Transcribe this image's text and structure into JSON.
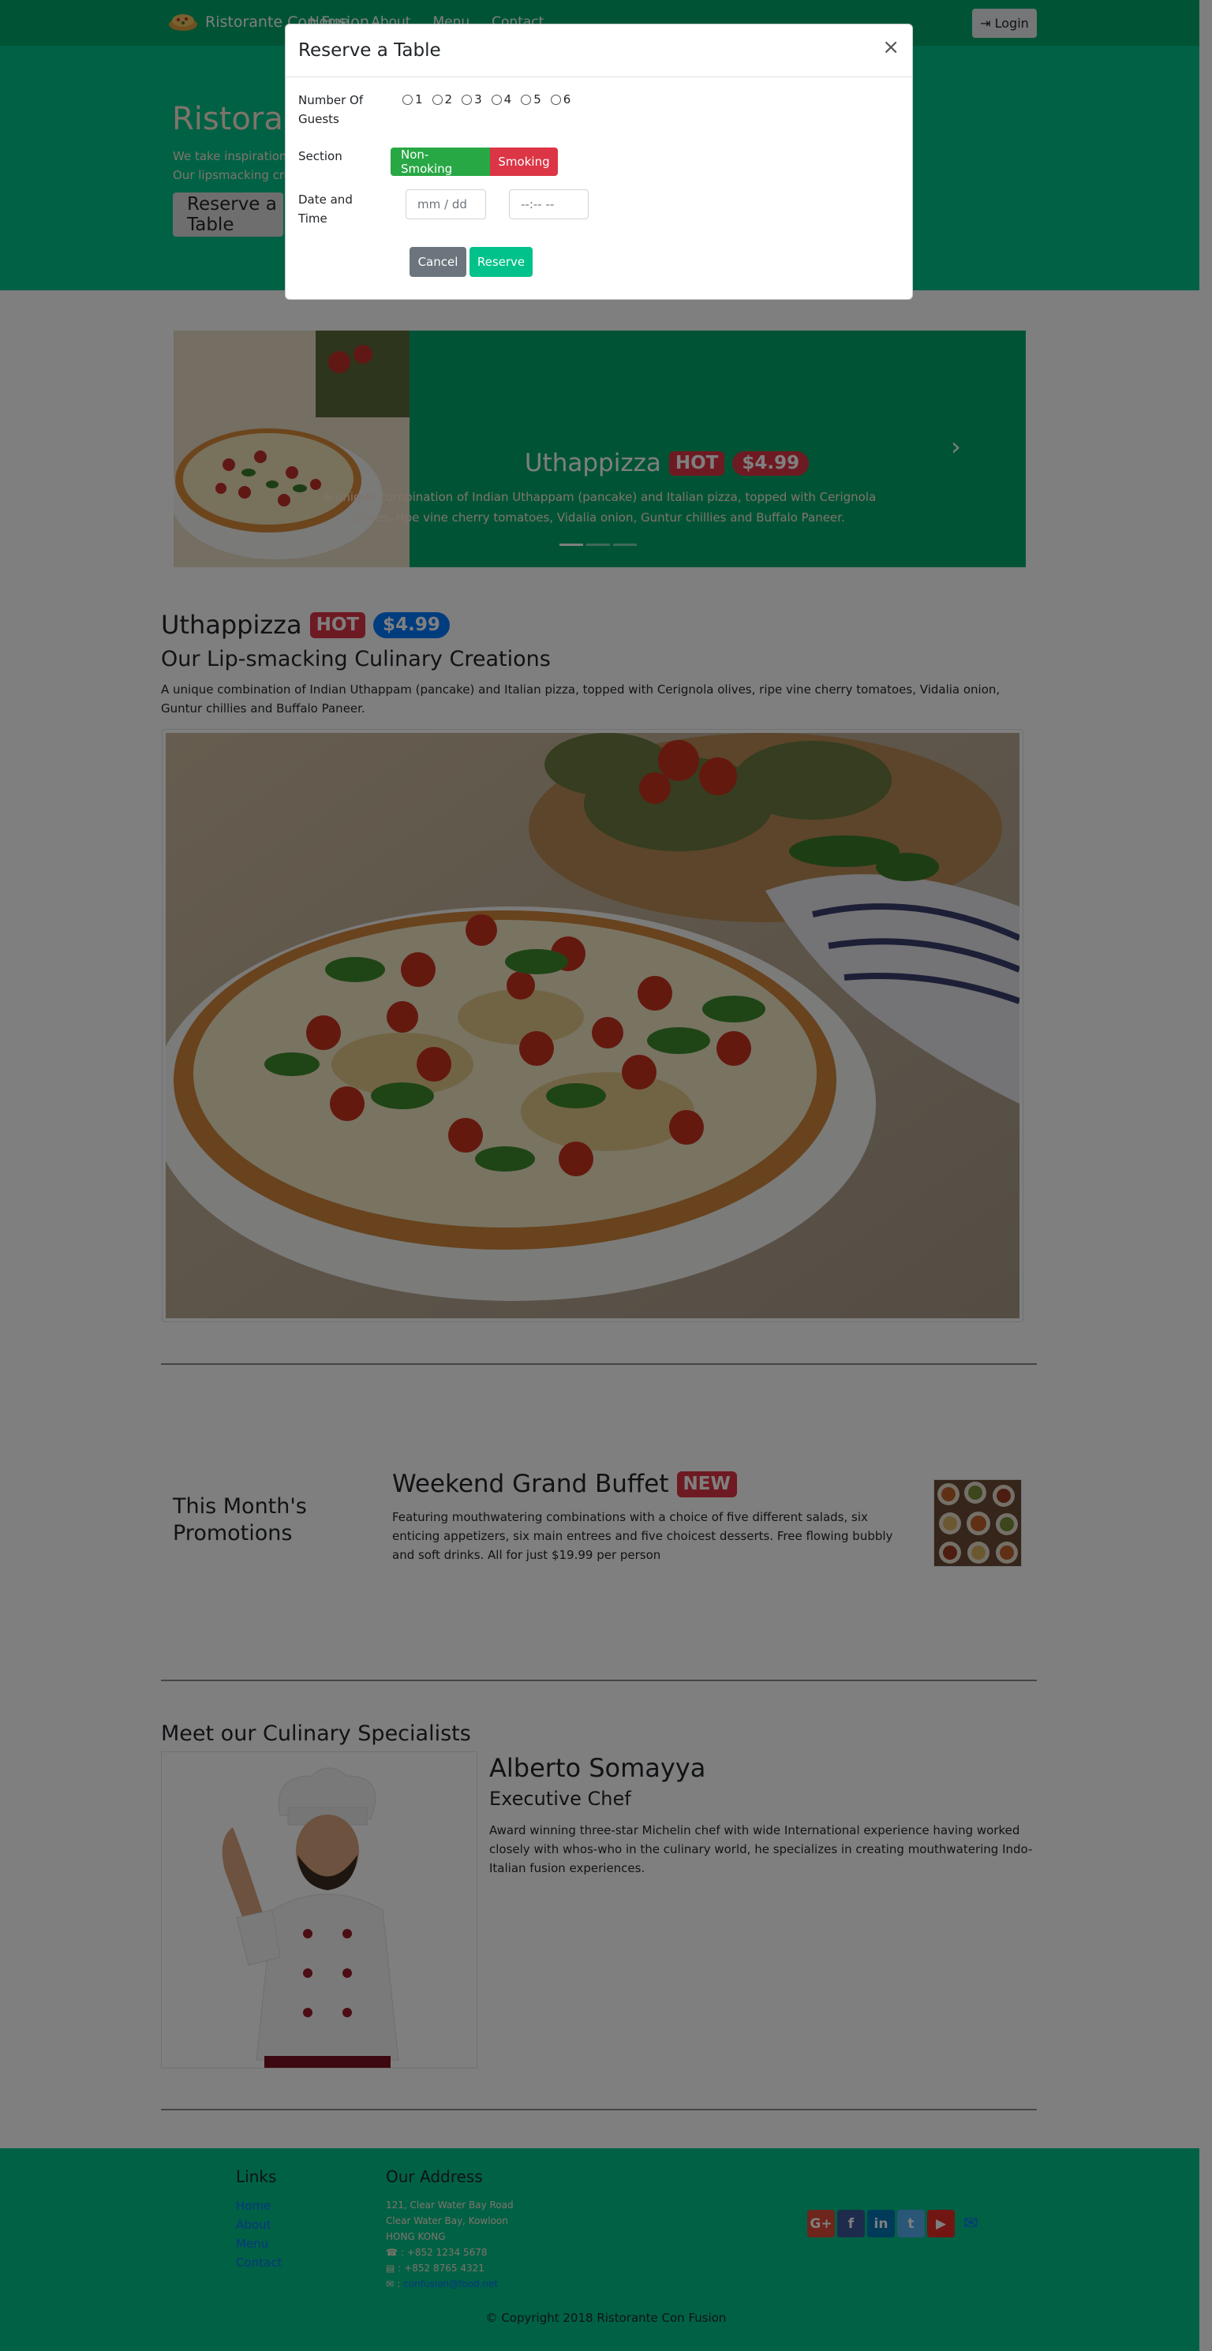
{
  "navbar": {
    "brand": "Ristorante Con Fusion",
    "links": [
      "Home",
      "About",
      "Menu",
      "Contact"
    ],
    "login_label": "Login"
  },
  "jumbotron": {
    "title": "Ristorante Con Fusion",
    "text_line1": "We take inspiration from the World's best cuisines, and create a unique fusion experience.",
    "text_line2": "Our lipsmacking creations will tickle your culinary senses!",
    "reserve_label": "Reserve a Table"
  },
  "carousel": {
    "title": "Uthappizza",
    "badge_hot": "HOT",
    "badge_price": "$4.99",
    "text": "A unique combination of Indian Uthappam (pancake) and Italian pizza, topped with Cerignola olives, ripe vine cherry tomatoes, Vidalia onion, Guntur chillies and Buffalo Paneer."
  },
  "dish": {
    "title": "Uthappizza",
    "badge_hot": "HOT",
    "badge_price": "$4.99",
    "subtitle": "Our Lip-smacking Culinary Creations",
    "text": "A unique combination of Indian Uthappam (pancake) and Italian pizza, topped with Cerignola olives, ripe vine cherry tomatoes, Vidalia onion, Guntur chillies and Buffalo Paneer."
  },
  "promo": {
    "label": "This Month's Promotions",
    "title": "Weekend Grand Buffet",
    "badge_new": "NEW",
    "text": "Featuring mouthwatering combinations with a choice of five different salads, six enticing appetizers, six main entrees and five choicest desserts. Free flowing bubbly and soft drinks. All for just $19.99 per person"
  },
  "chef": {
    "heading": "Meet our Culinary Specialists",
    "name": "Alberto Somayya",
    "role": "Executive Chef",
    "text": "Award winning three-star Michelin chef with wide International experience having worked closely with whos-who in the culinary world, he specializes in creating mouthwatering Indo-Italian fusion experiences."
  },
  "footer": {
    "links_heading": "Links",
    "links": [
      "Home",
      "About",
      "Menu",
      "Contact"
    ],
    "address_heading": "Our Address",
    "address_lines": [
      "121, Clear Water Bay Road",
      "Clear Water Bay, Kowloon",
      "HONG KONG"
    ],
    "phone": ": +852 1234 5678",
    "fax": ": +852 8765 4321",
    "email": "confusion@food.net",
    "copyright": "© Copyright 2018 Ristorante Con Fusion"
  },
  "modal": {
    "title": "Reserve a Table",
    "close": "×",
    "guests_label": "Number Of Guests",
    "guest_options": [
      "1",
      "2",
      "3",
      "4",
      "5",
      "6"
    ],
    "section_label": "Section",
    "section_options": [
      "Non-Smoking",
      "Smoking"
    ],
    "datetime_label": "Date and Time",
    "date_placeholder": "mm / dd",
    "time_placeholder": "--:--  --",
    "cancel_label": "Cancel",
    "reserve_label": "Reserve"
  },
  "colors": {
    "primary_dark": "#00a86b",
    "primary_light": "#00c28a",
    "danger": "#dc3545",
    "success": "#28a745",
    "badge_blue": "#007bff"
  }
}
